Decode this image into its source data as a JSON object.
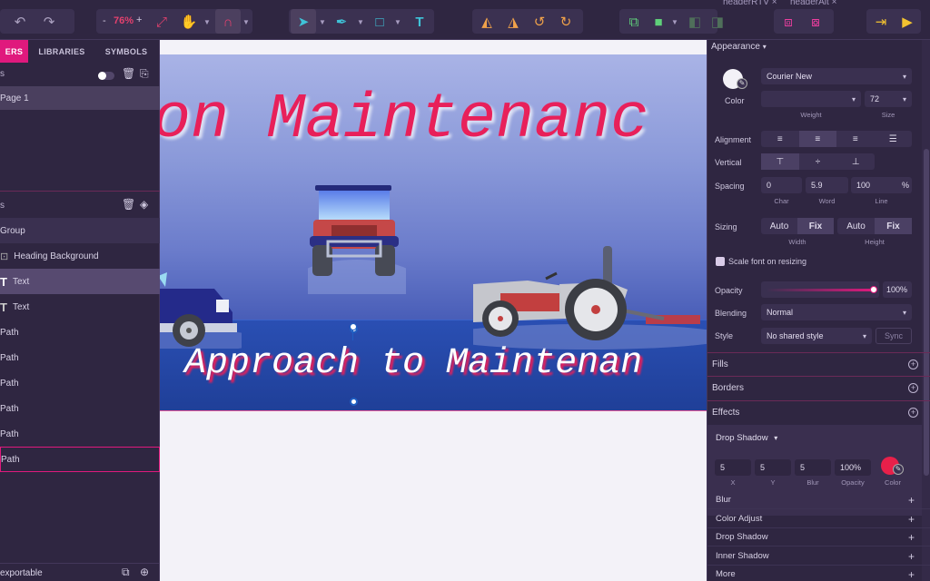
{
  "topbar": {
    "zoom": "76%",
    "zoom_minus": "-",
    "zoom_plus": "+",
    "doc_tabs": [
      "headerRTV ×",
      "headerAlt ×"
    ]
  },
  "left_panel": {
    "tabs": [
      "ERS",
      "LIBRARIES",
      "SYMBOLS"
    ],
    "pages_header": "s",
    "page_item": "Page 1",
    "layers_header": "s",
    "layers": [
      "Group",
      "Heading Background",
      "Text",
      "Text",
      "Path",
      "Path",
      "Path",
      "Path",
      "Path",
      "Path"
    ],
    "footer": "exportable"
  },
  "canvas": {
    "heading_text": "on Maintenanc",
    "subheading_text": "Approach to Maintenan"
  },
  "right_panel": {
    "appearance_title": "Appearance",
    "font_family": "Courier New",
    "color_label": "Color",
    "weight_value": "",
    "size_value": "72",
    "weight_label": "Weight",
    "size_label": "Size",
    "alignment_label": "Alignment",
    "vertical_label": "Vertical",
    "spacing_label": "Spacing",
    "char_value": "0",
    "word_value": "5.9",
    "line_value": "100",
    "line_unit": "%",
    "char_label": "Char",
    "word_label": "Word",
    "line_label": "Line",
    "sizing_label": "Sizing",
    "auto1": "Auto",
    "fix1": "Fix",
    "auto2": "Auto",
    "fix2": "Fix",
    "width_label": "Width",
    "height_label": "Height",
    "scale_font_label": "Scale font on resizing",
    "opacity_label": "Opacity",
    "opacity_value": "100%",
    "opacity_level": 1.0,
    "blending_label": "Blending",
    "blending_value": "Normal",
    "style_label": "Style",
    "style_value": "No shared style",
    "sync_label": "Sync",
    "fills_title": "Fills",
    "borders_title": "Borders",
    "effects_title": "Effects",
    "drop_shadow_title": "Drop Shadow",
    "shadow_x": "5",
    "shadow_y": "5",
    "shadow_blur": "5",
    "shadow_opacity": "100%",
    "x_label": "X",
    "y_label": "Y",
    "blur_label": "Blur",
    "opacity_sub_label": "Opacity",
    "color_sub_label": "Color",
    "shadow_color": "#e8204a",
    "effects_list": [
      "Blur",
      "Color Adjust",
      "Drop Shadow",
      "Inner Shadow",
      "More"
    ]
  },
  "colors": {
    "accent": "#e0197d",
    "panel": "#2f2641",
    "teal": "#3fc3d8",
    "heading_red": "#e8205a"
  }
}
